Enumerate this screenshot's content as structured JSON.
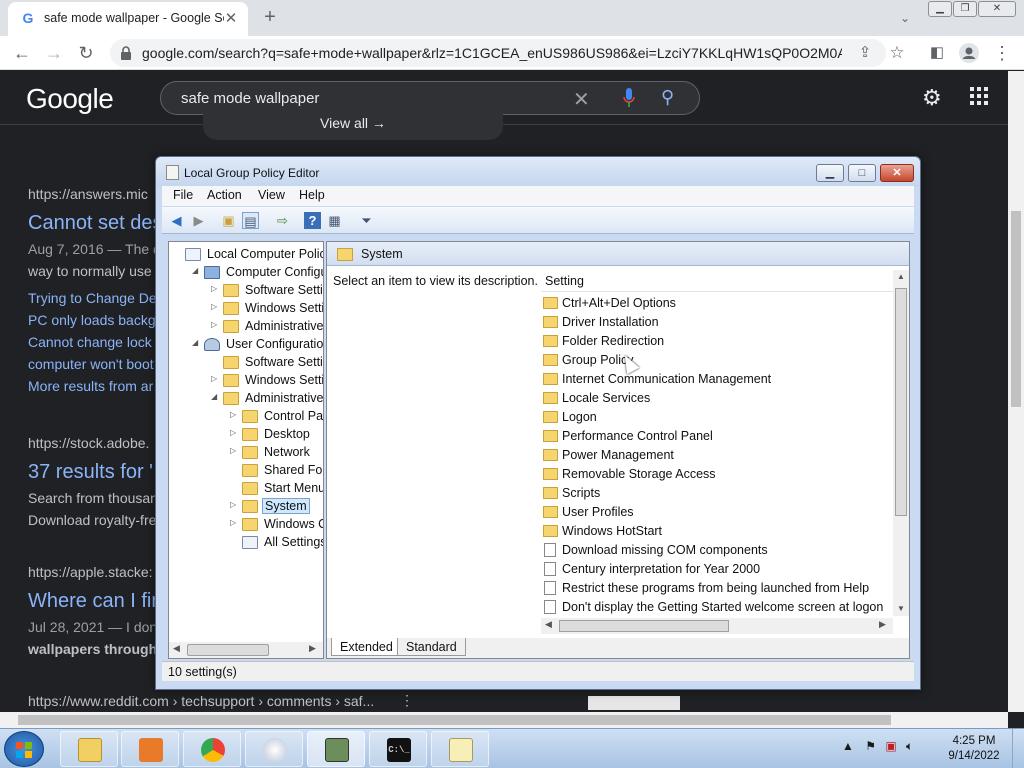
{
  "browser": {
    "tab_title": "safe mode wallpaper - Google Se",
    "tab_favicon": "G",
    "url": "google.com/search?q=safe+mode+wallpaper&rlz=1C1GCEA_enUS986US986&ei=LzciY7KKLqHW1sQP0O2M0AI..."
  },
  "google": {
    "logo": "Google",
    "query": "safe mode wallpaper",
    "view_all": "View all  →",
    "results": [
      {
        "url": "https://answers.mic",
        "title": "Cannot set des",
        "date": "Aug 7, 2016 — The d",
        "snippet": "way to normally use",
        "links": [
          "Trying to Change De",
          "PC only loads backg",
          "Cannot change lock",
          "computer won't boot",
          "More results from ar"
        ]
      },
      {
        "url": "https://stock.adobe.",
        "title": "37 results for '",
        "snippet": "Search from thousan",
        "snippet2": "Download royalty-fre"
      },
      {
        "url": "https://apple.stacke:",
        "title": "Where can I fir",
        "date": "Jul 28, 2021 — I don'",
        "snippet": "wallpapers through S"
      },
      {
        "url": "https://www.reddit.com › techsupport › comments › saf...",
        "more_icon": "⋮"
      }
    ]
  },
  "gpedit": {
    "title": "Local Group Policy Editor",
    "menu": [
      "File",
      "Action",
      "View",
      "Help"
    ],
    "tree": [
      {
        "label": "Local Computer Policy",
        "indent": 0,
        "arrow": "",
        "icon": "policy"
      },
      {
        "label": "Computer Configura",
        "indent": 1,
        "arrow": "◢",
        "icon": "computer"
      },
      {
        "label": "Software Settings",
        "indent": 2,
        "arrow": "▷",
        "icon": "folder"
      },
      {
        "label": "Windows Setting",
        "indent": 2,
        "arrow": "▷",
        "icon": "folder"
      },
      {
        "label": "Administrative Te",
        "indent": 2,
        "arrow": "▷",
        "icon": "folder"
      },
      {
        "label": "User Configuration",
        "indent": 1,
        "arrow": "◢",
        "icon": "user"
      },
      {
        "label": "Software Settings",
        "indent": 2,
        "arrow": "",
        "icon": "folder"
      },
      {
        "label": "Windows Setting",
        "indent": 2,
        "arrow": "▷",
        "icon": "folder"
      },
      {
        "label": "Administrative Te",
        "indent": 2,
        "arrow": "◢",
        "icon": "folder"
      },
      {
        "label": "Control Panel",
        "indent": 3,
        "arrow": "▷",
        "icon": "folder"
      },
      {
        "label": "Desktop",
        "indent": 3,
        "arrow": "▷",
        "icon": "folder"
      },
      {
        "label": "Network",
        "indent": 3,
        "arrow": "▷",
        "icon": "folder"
      },
      {
        "label": "Shared Folder",
        "indent": 3,
        "arrow": "",
        "icon": "folder"
      },
      {
        "label": "Start Menu ar",
        "indent": 3,
        "arrow": "",
        "icon": "folder"
      },
      {
        "label": "System",
        "indent": 3,
        "arrow": "▷",
        "icon": "folder",
        "selected": true
      },
      {
        "label": "Windows Cor",
        "indent": 3,
        "arrow": "▷",
        "icon": "folder"
      },
      {
        "label": "All Settings",
        "indent": 3,
        "arrow": "",
        "icon": "settings"
      }
    ],
    "right_header": "System",
    "description": "Select an item to view its description.",
    "column_header": "Setting",
    "settings": [
      {
        "label": "Ctrl+Alt+Del Options",
        "type": "folder"
      },
      {
        "label": "Driver Installation",
        "type": "folder"
      },
      {
        "label": "Folder Redirection",
        "type": "folder"
      },
      {
        "label": "Group Policy",
        "type": "folder"
      },
      {
        "label": "Internet Communication Management",
        "type": "folder"
      },
      {
        "label": "Locale Services",
        "type": "folder"
      },
      {
        "label": "Logon",
        "type": "folder"
      },
      {
        "label": "Performance Control Panel",
        "type": "folder"
      },
      {
        "label": "Power Management",
        "type": "folder"
      },
      {
        "label": "Removable Storage Access",
        "type": "folder"
      },
      {
        "label": "Scripts",
        "type": "folder"
      },
      {
        "label": "User Profiles",
        "type": "folder"
      },
      {
        "label": "Windows HotStart",
        "type": "folder"
      },
      {
        "label": "Download missing COM components",
        "type": "setting"
      },
      {
        "label": "Century interpretation for Year 2000",
        "type": "setting"
      },
      {
        "label": "Restrict these programs from being launched from Help",
        "type": "setting"
      },
      {
        "label": "Don't display the Getting Started welcome screen at logon",
        "type": "setting"
      }
    ],
    "tabs": [
      "Extended",
      "Standard"
    ],
    "status": "10 setting(s)"
  },
  "taskbar": {
    "time": "4:25 PM",
    "date": "9/14/2022",
    "apps": [
      "explorer",
      "media-player",
      "chrome",
      "generic",
      "gpedit",
      "cmd",
      "notepad"
    ]
  }
}
